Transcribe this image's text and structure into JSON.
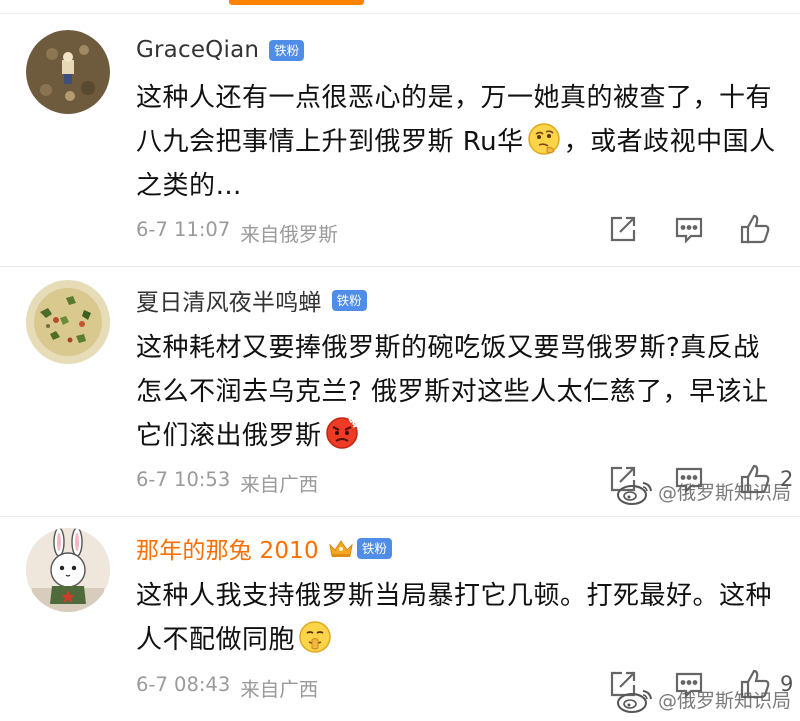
{
  "comments": [
    {
      "username": "GraceQian",
      "badge": "铁粉",
      "text_before_emoji": "这种人还有一点很恶心的是，万一她真的被查了，十有八九会把事情上升到俄罗斯 Ru华",
      "emoji": "thinking-emoji",
      "text_after_emoji": "，或者歧视中国人之类的…",
      "time": "6-7 11:07",
      "source": "来自俄罗斯",
      "likes": ""
    },
    {
      "username": "夏日清风夜半鸣蝉",
      "badge": "铁粉",
      "text_before_emoji": "这种耗材又要捧俄罗斯的碗吃饭又要骂俄罗斯?真反战怎么不润去乌克兰? 俄罗斯对这些人太仁慈了，早该让它们滚出俄罗斯",
      "emoji": "angry-emoji",
      "text_after_emoji": "",
      "time": "6-7 10:53",
      "source": "来自广西",
      "likes": "2"
    },
    {
      "username": "那年的那兔 2010",
      "badge": "铁粉",
      "text_before_emoji": "这种人我支持俄罗斯当局暴打它几顿。打死最好。这种人不配做同胞",
      "emoji": "shush-emoji",
      "text_after_emoji": "",
      "time": "6-7 08:43",
      "source": "来自广西",
      "likes": "9"
    }
  ],
  "watermark": "@俄罗斯知识局",
  "colors": {
    "accent": "#ff8200",
    "badge": "#4f8de8",
    "vip_name": "#ff6e00",
    "meta": "#9a9a9a"
  },
  "icons": {
    "share": "share-icon",
    "reply": "comment-icon",
    "like": "thumbs-up-icon",
    "watermark": "weibo-logo-icon"
  }
}
